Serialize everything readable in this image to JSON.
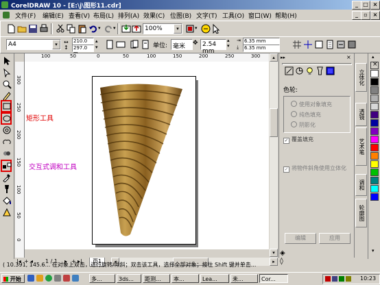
{
  "title_bar": {
    "title": "CorelDRAW 10 - [E:\\j\\图形11.cdr]",
    "buttons": [
      "_",
      "□",
      "×"
    ]
  },
  "menu": {
    "items": [
      "文件(F)",
      "编辑(E)",
      "查看(V)",
      "布局(L)",
      "排列(A)",
      "效果(C)",
      "位图(B)",
      "文字(T)",
      "工具(O)",
      "窗口(W)",
      "帮助(H)"
    ]
  },
  "toolbar": {
    "zoom_value": "100%"
  },
  "property_bar": {
    "paper_size": "A4",
    "width": "210.0 m",
    "height": "297.0 m",
    "unit_label": "单位:",
    "unit_value": "毫米",
    "nudge_value": "2.54 mm",
    "dup_x": "6.35 mm",
    "dup_y": "6.35 mm"
  },
  "rulers": {
    "top": [
      "100",
      "50",
      "0",
      "50",
      "100",
      "150",
      "200",
      "250",
      "300"
    ],
    "left": [
      "300",
      "250",
      "200",
      "150",
      "100",
      "50",
      "0"
    ]
  },
  "annotations": {
    "rect_tool": "矩形工具",
    "blend_tool": "交互式调和工具"
  },
  "page_nav": {
    "current": "1 / 1",
    "tab": "页1"
  },
  "docker": {
    "section_title": "色轮:",
    "options": [
      "使用对象填充",
      "纯色填充",
      "阴影化"
    ],
    "overlay_fill": "覆盖填充",
    "bevel_option": "将物件斜角使用立体化",
    "edit_button": "编辑",
    "apply_button": "应用",
    "tabs": [
      "立体化",
      "透镜",
      "艺术笔",
      "调和",
      "轮廓图"
    ]
  },
  "palette": {
    "colors": [
      "#ffffff",
      "#000000",
      "#808080",
      "#b0b0b0",
      "#d8d8d8",
      "#400080",
      "#0000a0",
      "#8000c0",
      "#ff00ff",
      "#ff0000",
      "#ff8000",
      "#ffff00",
      "#00c000",
      "#008080",
      "#00ffff",
      "#0000ff"
    ]
  },
  "status": {
    "text": "( 10.391, 145.6...     在对象上双击，进行旋转/倾斜；双击该工具，选择全部对象；按住 Shift 键并单击..."
  },
  "taskbar": {
    "start": "开始",
    "tasks": [
      "多...",
      "3ds...",
      "距测...",
      "本...",
      "Lea...",
      "未...",
      "Cor..."
    ],
    "clock": "10:23"
  }
}
